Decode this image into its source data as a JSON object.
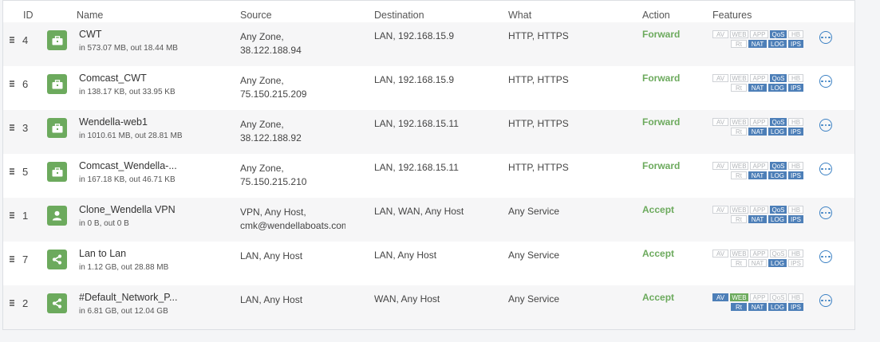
{
  "headers": {
    "id": "ID",
    "name": "Name",
    "source": "Source",
    "destination": "Destination",
    "what": "What",
    "action": "Action",
    "features": "Features"
  },
  "feature_labels": [
    "AV",
    "WEB",
    "APP",
    "QoS",
    "HB",
    "Rt",
    "NAT",
    "LOG",
    "IPS"
  ],
  "colors": {
    "accent_green": "#6caa5d",
    "badge_on": "#4d7fb8",
    "more_blue": "#3d82c4"
  },
  "rules": [
    {
      "id": "4",
      "name": "CWT",
      "traffic": "in 573.07 MB, out 18.44 MB",
      "icon": "briefcase-icon",
      "source_line1": "Any Zone,",
      "source_line2": "38.122.188.94",
      "destination": "LAN, 192.168.15.9",
      "what": "HTTP, HTTPS",
      "action": "Forward",
      "features_on": [
        "QoS",
        "NAT",
        "LOG",
        "IPS"
      ]
    },
    {
      "id": "6",
      "name": "Comcast_CWT",
      "traffic": "in 138.17 KB, out 33.95 KB",
      "icon": "briefcase-icon",
      "source_line1": "Any Zone,",
      "source_line2": "75.150.215.209",
      "destination": "LAN, 192.168.15.9",
      "what": "HTTP, HTTPS",
      "action": "Forward",
      "features_on": [
        "QoS",
        "NAT",
        "LOG",
        "IPS"
      ]
    },
    {
      "id": "3",
      "name": "Wendella-web1",
      "traffic": "in 1010.61 MB, out 28.81 MB",
      "icon": "briefcase-icon",
      "source_line1": "Any Zone,",
      "source_line2": "38.122.188.92",
      "destination": "LAN, 192.168.15.11",
      "what": "HTTP, HTTPS",
      "action": "Forward",
      "features_on": [
        "QoS",
        "NAT",
        "LOG",
        "IPS"
      ]
    },
    {
      "id": "5",
      "name": "Comcast_Wendella-...",
      "traffic": "in 167.18 KB, out 46.71 KB",
      "icon": "briefcase-icon",
      "source_line1": "Any Zone,",
      "source_line2": "75.150.215.210",
      "destination": "LAN, 192.168.15.11",
      "what": "HTTP, HTTPS",
      "action": "Forward",
      "features_on": [
        "QoS",
        "NAT",
        "LOG",
        "IPS"
      ]
    },
    {
      "id": "1",
      "name": "Clone_Wendella VPN",
      "traffic": "in 0 B, out 0 B",
      "icon": "user-icon",
      "source_line1": "VPN, Any Host,",
      "source_line2": "cmk@wendellaboats.com",
      "destination": "LAN, WAN, Any Host",
      "what": "Any Service",
      "action": "Accept",
      "features_on": [
        "QoS",
        "NAT",
        "LOG",
        "IPS"
      ]
    },
    {
      "id": "7",
      "name": "Lan to Lan",
      "traffic": "in 1.12 GB, out 28.88 MB",
      "icon": "share-icon",
      "source_line1": "LAN, Any Host",
      "source_line2": "",
      "destination": "LAN, Any Host",
      "what": "Any Service",
      "action": "Accept",
      "features_on": [
        "LOG"
      ]
    },
    {
      "id": "2",
      "name": "#Default_Network_P...",
      "traffic": "in 6.81 GB, out 12.04 GB",
      "icon": "share-icon",
      "source_line1": "LAN, Any Host",
      "source_line2": "",
      "destination": "WAN, Any Host",
      "what": "Any Service",
      "action": "Accept",
      "features_on": [
        "AV",
        "WEB",
        "Rt",
        "NAT",
        "LOG",
        "IPS"
      ]
    }
  ]
}
